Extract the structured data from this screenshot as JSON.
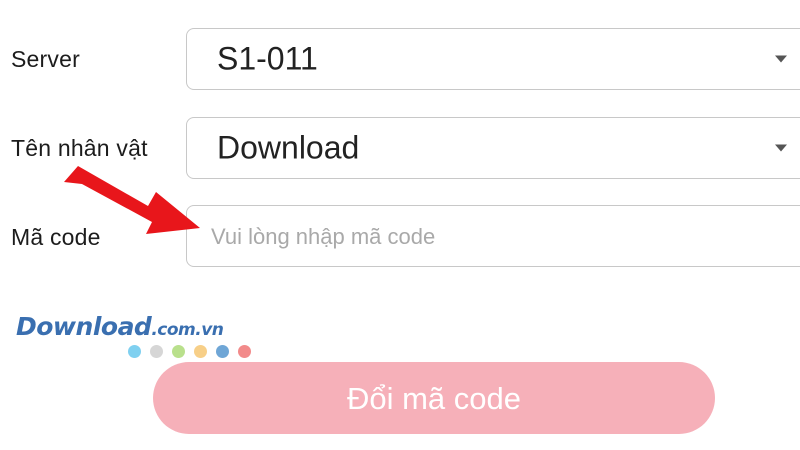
{
  "form": {
    "server": {
      "label": "Server",
      "value": "S1-011"
    },
    "character": {
      "label": "Tên nhân vật",
      "value": "Download"
    },
    "code": {
      "label": "Mã code",
      "placeholder": "Vui lòng nhập mã code",
      "value": ""
    },
    "submit_label": "Đổi mã code"
  },
  "watermark": {
    "brand": "Download",
    "tld": ".com.vn",
    "dot_colors": [
      "#7fd0f0",
      "#d6d6d6",
      "#b9e08c",
      "#f7cf88",
      "#6fa6d6",
      "#f28a8a"
    ]
  },
  "annotation": {
    "arrow_color": "#e8161b",
    "icon": "red-arrow-icon"
  },
  "colors": {
    "button_bg": "#f6b0b9",
    "field_border": "#c8c8c8"
  }
}
